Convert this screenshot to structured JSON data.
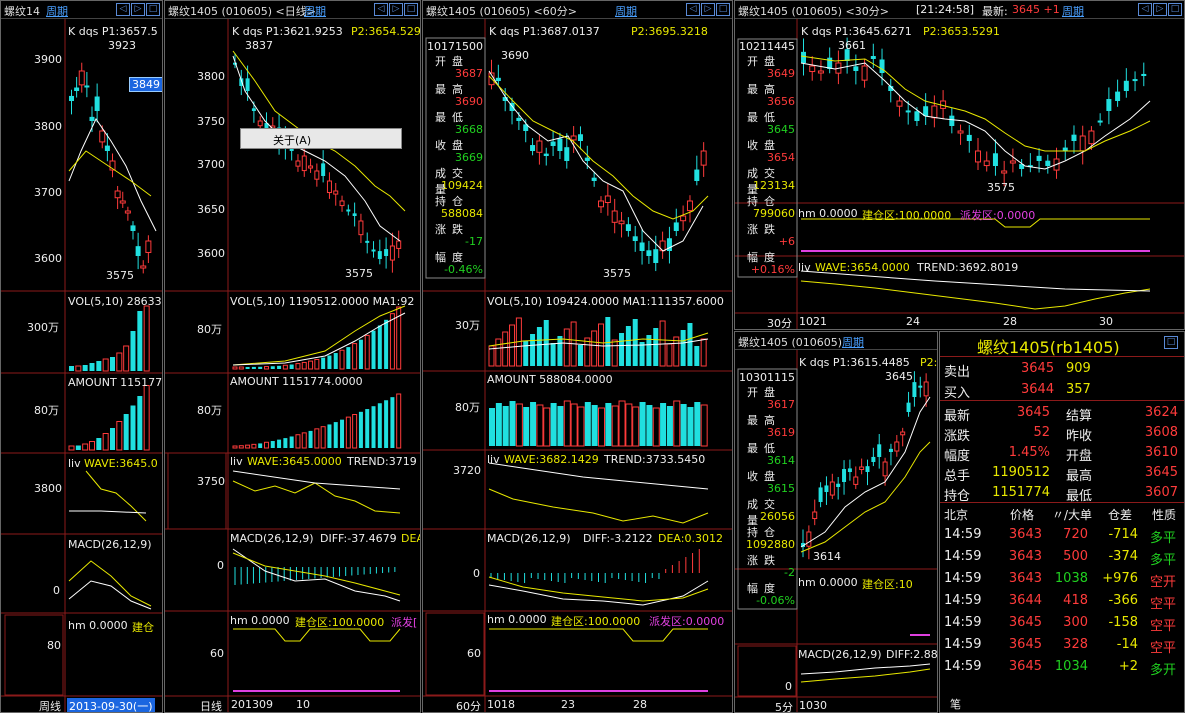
{
  "colors": {
    "up": "#ff3b3b",
    "down": "#20e0e0",
    "ma1": "#ffffff",
    "ma2": "#e8e800",
    "bg": "#000000",
    "grid": "#8b1a1a"
  },
  "win1": {
    "title": "螺纹14",
    "period": "周期",
    "kline": "K  dqs P1:3657.5",
    "hi_label": "3923",
    "lo_label": "3575",
    "sel_price": "3849",
    "y_ticks": [
      "3900",
      "3800",
      "3700",
      "3600"
    ],
    "vol": "VOL(5,10) 28633",
    "vol_tick": "300万",
    "amount": "AMOUNT 115177",
    "amt_tick": "80万",
    "liv": "liv",
    "wave": "WAVE:3645.0",
    "liv_tick": "3800",
    "macd": "MACD(26,12,9)",
    "macd_tick": "0",
    "hm": "hm 0.0000",
    "hm2": "建仓",
    "hm_tick": "80",
    "axis": "周线",
    "date": "2013-09-30(一)"
  },
  "win2": {
    "title": "螺纹1405 (010605) <日线>",
    "period": "周期",
    "kline": "K  dqs P1:3621.9253",
    "p2": "P2:3654.529",
    "hi_label": "3837",
    "lo_label": "3575",
    "menu": "关于(A)",
    "y_ticks": [
      "3800",
      "3750",
      "3700",
      "3650",
      "3600"
    ],
    "vol": "VOL(5,10) 1190512.0000 MA1:92",
    "vol_tick": "80万",
    "amount": "AMOUNT 1151774.0000",
    "amt_tick": "80万",
    "liv": "liv",
    "wave": "WAVE:3645.0000",
    "trend": "TREND:3719",
    "liv_tick": "3750",
    "macd": "MACD(26,12,9)",
    "diff": "DIFF:-37.4679",
    "dea": "DEA",
    "macd_tick": "0",
    "hm": "hm 0.0000",
    "hm2": "建仓区:100.0000",
    "hm3": "派发[",
    "hm_tick": "60",
    "axis": "日线",
    "x_labels": [
      "201309",
      "10"
    ]
  },
  "win3": {
    "title": "螺纹1405 (010605) <60分>",
    "period": "周期",
    "kline": "K  dqs P1:3687.0137",
    "p2": "P2:3695.3218",
    "hi_label": "3690",
    "lo_label": "3575",
    "info": {
      "time": "10171500",
      "rows": [
        [
          "开",
          "盘",
          "3687",
          "red"
        ],
        [
          "最",
          "高",
          "3690",
          "red"
        ],
        [
          "最",
          "低",
          "3668",
          "grn"
        ],
        [
          "收",
          "盘",
          "3669",
          "grn"
        ],
        [
          "成交量",
          "",
          "109424",
          "yel"
        ],
        [
          "持",
          "仓",
          "588084",
          "yel"
        ],
        [
          "涨",
          "跌",
          "-17",
          "grn"
        ],
        [
          "幅",
          "度",
          "-0.46%",
          "grn"
        ]
      ]
    },
    "vol": "VOL(5,10) 109424.0000 MA1:111357.6000",
    "vol_tick": "30万",
    "amount": "AMOUNT 588084.0000",
    "amt_tick": "80万",
    "liv": "liv",
    "wave": "WAVE:3682.1429",
    "trend": "TREND:3733.5450",
    "liv_tick": "3720",
    "macd": "MACD(26,12,9)",
    "diff": "DIFF:-3.2122",
    "dea": "DEA:0.3012",
    "macd_tick": "0",
    "hm": "hm 0.0000",
    "hm2": "建仓区:100.0000",
    "hm3": "派发区:0.0000",
    "hm_tick": "60",
    "axis": "60分",
    "x_labels": [
      "1018",
      "23",
      "28"
    ]
  },
  "win4": {
    "title": "螺纹1405 (010605) <30分>",
    "time": "[21:24:58]",
    "latest": "最新:",
    "latest_val": "3645 +1",
    "period": "周期",
    "kline": "K  dqs P1:3645.6271",
    "p2": "P2:3653.5291",
    "hi_label": "3661",
    "lo_label": "3575",
    "info": {
      "time": "10211445",
      "rows": [
        [
          "开",
          "盘",
          "3649",
          "red"
        ],
        [
          "最",
          "高",
          "3656",
          "red"
        ],
        [
          "最",
          "低",
          "3645",
          "grn"
        ],
        [
          "收",
          "盘",
          "3654",
          "red"
        ],
        [
          "成交量",
          "",
          "123134",
          "yel"
        ],
        [
          "持",
          "仓",
          "799060",
          "yel"
        ],
        [
          "涨",
          "跌",
          "+6",
          "red"
        ],
        [
          "幅",
          "度",
          "+0.16%",
          "red"
        ]
      ]
    },
    "hm": "hm 0.0000",
    "hm2": "建仓区:100.0000",
    "hm3": "派发区:0.0000",
    "liv": "liv",
    "wave": "WAVE:3654.0000",
    "trend": "TREND:3692.8019",
    "axis": "30分",
    "x_labels": [
      "1021",
      "24",
      "28",
      "30"
    ]
  },
  "win5": {
    "title": "螺纹1405 (010605)",
    "period": "周期",
    "kline": "K  dqs P1:3615.4485",
    "p2": "P2:",
    "hi_label": "3645",
    "lo_label": "3614",
    "info": {
      "time": "10301115",
      "rows": [
        [
          "开",
          "盘",
          "3617",
          "red"
        ],
        [
          "最",
          "高",
          "3619",
          "red"
        ],
        [
          "最",
          "低",
          "3614",
          "grn"
        ],
        [
          "收",
          "盘",
          "3615",
          "grn"
        ],
        [
          "成交量",
          "",
          "26056",
          "yel"
        ],
        [
          "持",
          "仓",
          "1092880",
          "yel"
        ],
        [
          "涨",
          "跌",
          "-2",
          "grn"
        ],
        [
          "幅",
          "度",
          "-0.06%",
          "grn"
        ]
      ]
    },
    "hm": "hm 0.0000",
    "hm2": "建仓区:10",
    "macd": "MACD(26,12,9)",
    "diff": "DIFF:2.88",
    "macd_tick": "0",
    "axis": "5分",
    "x_labels": [
      "1030"
    ]
  },
  "quote": {
    "title": "螺纹1405(rb1405)",
    "sell_label": "卖出",
    "sell_price": "3645",
    "sell_vol": "909",
    "buy_label": "买入",
    "buy_price": "3644",
    "buy_vol": "357",
    "rows": [
      [
        "最新",
        "3645",
        "red",
        "结算",
        "3624",
        "red"
      ],
      [
        "涨跌",
        "52",
        "red",
        "昨收",
        "3608",
        "red"
      ],
      [
        "幅度",
        "1.45%",
        "red",
        "开盘",
        "3610",
        "red"
      ],
      [
        "总手",
        "1190512",
        "yel",
        "最高",
        "3645",
        "red"
      ],
      [
        "持仓",
        "1151774",
        "yel",
        "最低",
        "3607",
        "red"
      ]
    ],
    "ticks_header": [
      "北京",
      "价格",
      "〃/大单",
      "仓差",
      "性质"
    ],
    "ticks": [
      [
        "14:59",
        "3643",
        "720",
        "-714",
        "多平"
      ],
      [
        "14:59",
        "3643",
        "500",
        "-374",
        "多平"
      ],
      [
        "14:59",
        "3643",
        "1038",
        "+976",
        "空开"
      ],
      [
        "14:59",
        "3644",
        "418",
        "-366",
        "空平"
      ],
      [
        "14:59",
        "3645",
        "300",
        "-158",
        "空平"
      ],
      [
        "14:59",
        "3645",
        "328",
        "-14",
        "空平"
      ],
      [
        "14:59",
        "3645",
        "1034",
        "+2",
        "多开"
      ]
    ],
    "footer": "笔"
  }
}
